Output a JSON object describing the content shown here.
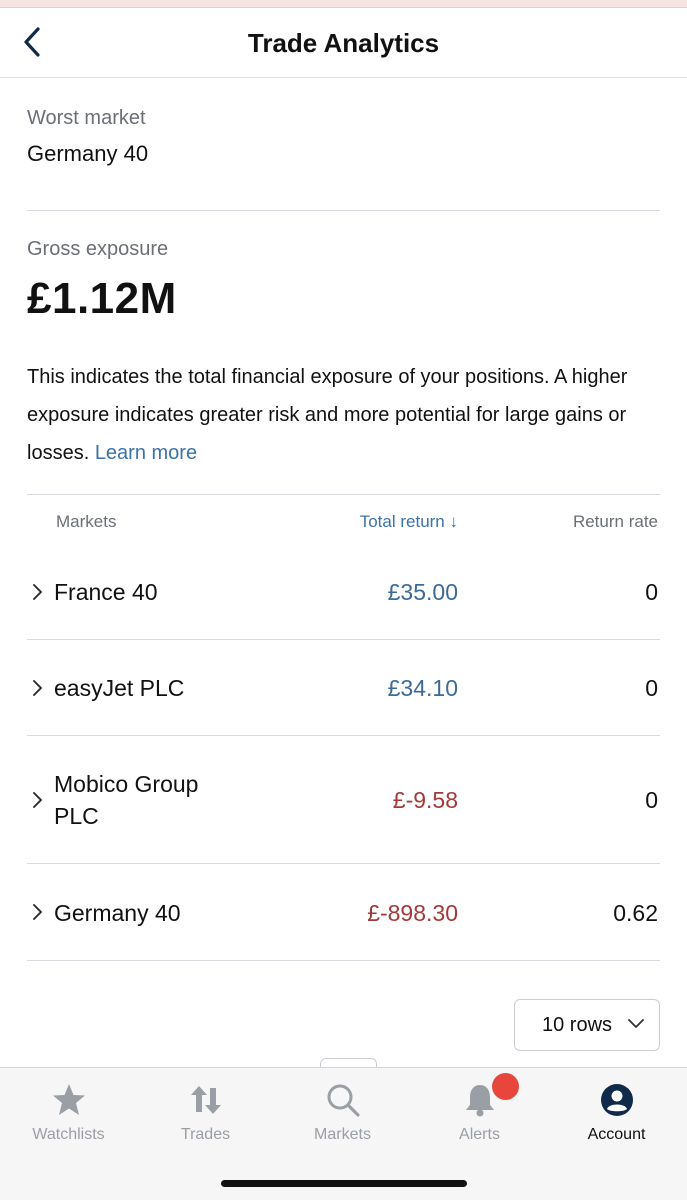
{
  "header": {
    "title": "Trade Analytics"
  },
  "worst_market": {
    "label": "Worst market",
    "value": "Germany 40"
  },
  "gross_exposure": {
    "label": "Gross exposure",
    "value": "£1.12M",
    "description": "This indicates the total financial exposure of your positions. A higher exposure indicates greater risk and more potential for large gains or losses.",
    "link_text": "Learn more"
  },
  "table": {
    "columns": {
      "markets": "Markets",
      "total_return": "Total return",
      "return_rate": "Return rate"
    },
    "sort_indicator": "↓",
    "rows": [
      {
        "market": "France 40",
        "total_return": "£35.00",
        "return_rate": "0",
        "sign": "positive"
      },
      {
        "market": "easyJet PLC",
        "total_return": "£34.10",
        "return_rate": "0",
        "sign": "positive"
      },
      {
        "market": "Mobico Group PLC",
        "total_return": "£-9.58",
        "return_rate": "0",
        "sign": "negative"
      },
      {
        "market": "Germany 40",
        "total_return": "£-898.30",
        "return_rate": "0.62",
        "sign": "negative"
      }
    ],
    "rows_per_page": "10 rows"
  },
  "tabbar": {
    "items": [
      {
        "label": "Watchlists",
        "icon": "star-icon",
        "active": false
      },
      {
        "label": "Trades",
        "icon": "trades-arrows-icon",
        "active": false
      },
      {
        "label": "Markets",
        "icon": "search-icon",
        "active": false
      },
      {
        "label": "Alerts",
        "icon": "bell-icon",
        "active": false,
        "badge": true
      },
      {
        "label": "Account",
        "icon": "account-icon",
        "active": true
      }
    ]
  },
  "colors": {
    "link": "#3b73a8",
    "positive": "#3b6a98",
    "negative": "#a33a3a",
    "active_icon": "#0f2a4a",
    "badge": "#e8453c"
  }
}
